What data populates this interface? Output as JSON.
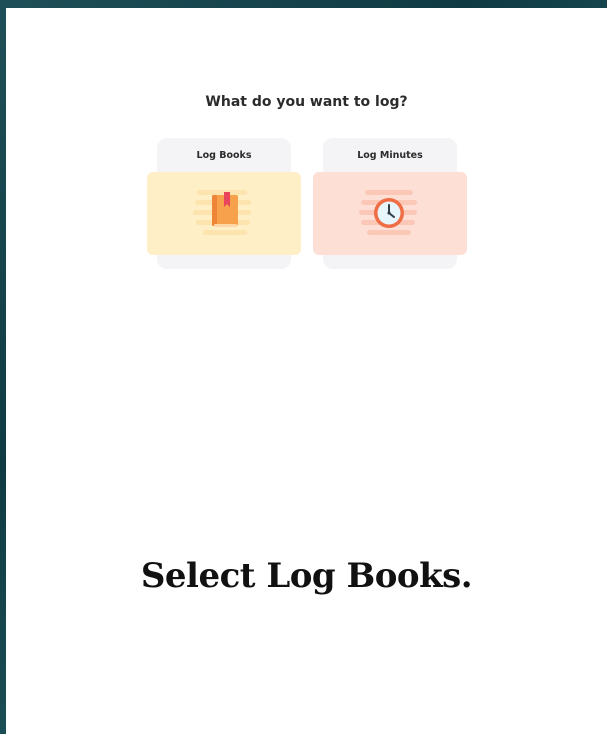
{
  "prompt": {
    "question": "What do you want to log?"
  },
  "options": [
    {
      "label": "Log Books",
      "icon": "book-icon",
      "face_color": "#ffefc7"
    },
    {
      "label": "Log Minutes",
      "icon": "clock-icon",
      "face_color": "#fddfd6"
    }
  ],
  "instruction": {
    "text": "Select Log Books."
  }
}
